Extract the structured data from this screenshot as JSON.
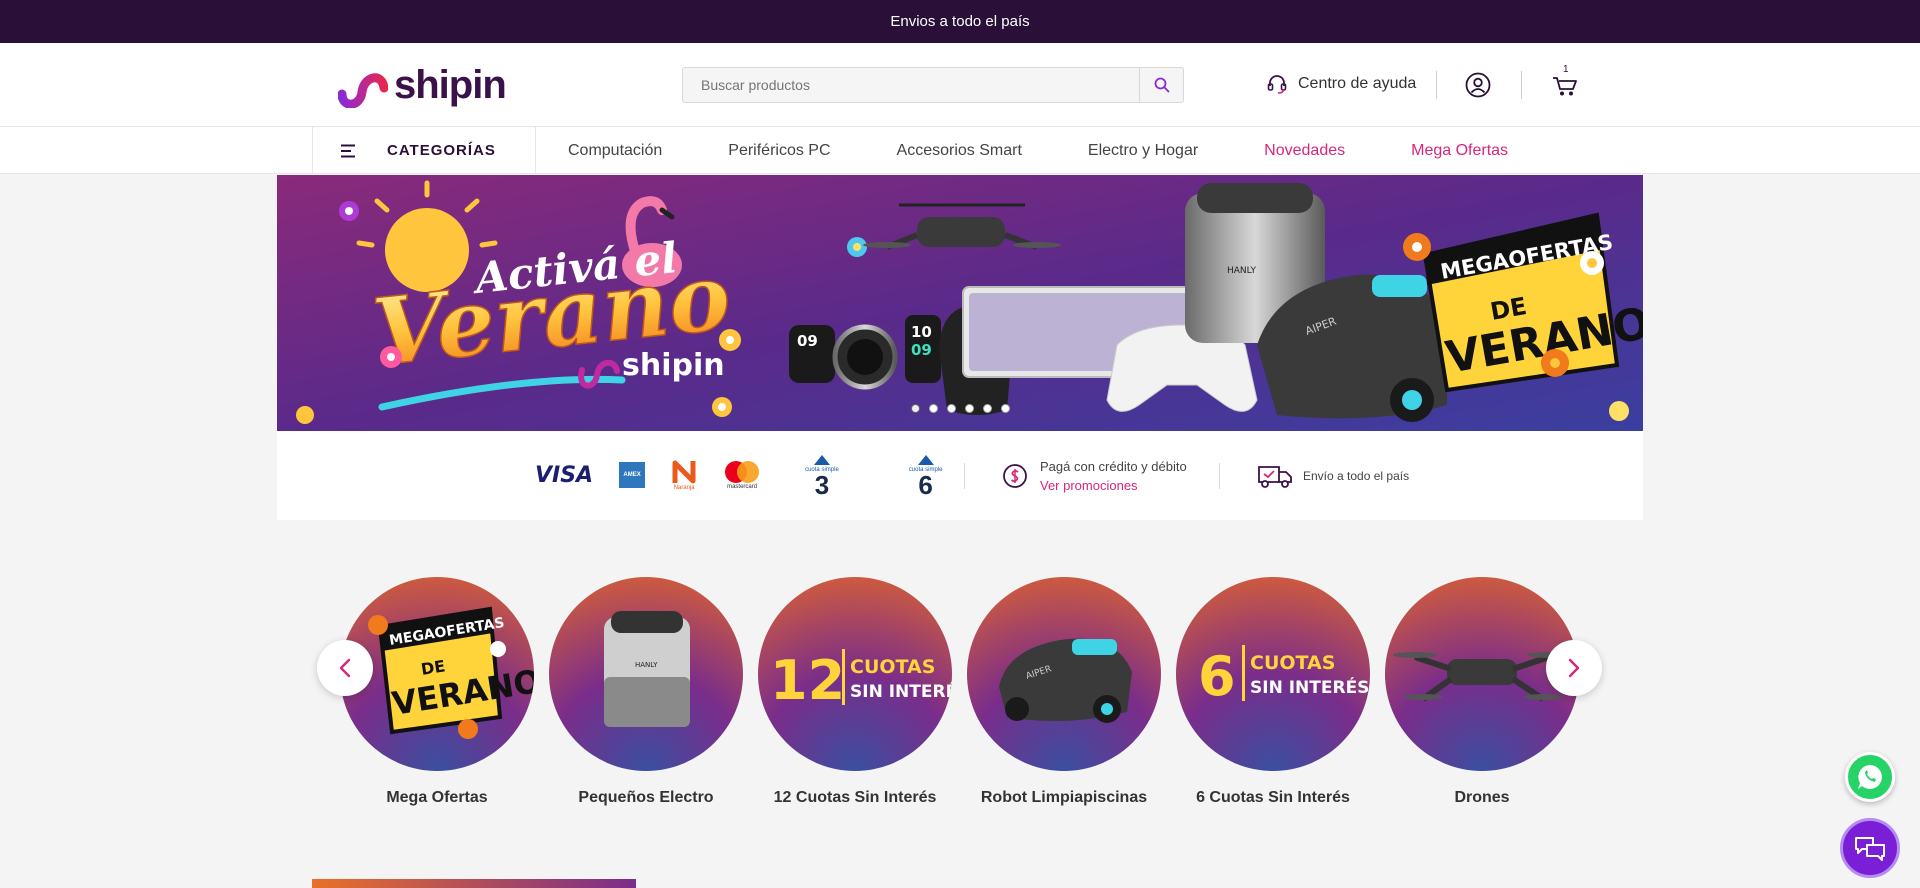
{
  "topbar": {
    "text": "Envios a todo el país"
  },
  "header": {
    "logo_text": "shipin",
    "search_placeholder": "Buscar productos",
    "help_label": "Centro de ayuda",
    "cart_count": "1"
  },
  "nav": {
    "categories_label": "CATEGORÍAS",
    "links": [
      {
        "label": "Computación"
      },
      {
        "label": "Periféricos PC"
      },
      {
        "label": "Accesorios Smart"
      },
      {
        "label": "Electro y Hogar"
      },
      {
        "label": "Novedades"
      },
      {
        "label": "Mega Ofertas"
      }
    ]
  },
  "banner": {
    "headline_line1": "Activá el",
    "headline_line2": "Verano",
    "brand": "shipin",
    "badge_line1": "MEGAOFERTAS",
    "badge_line2": "DE",
    "badge_line3": "VERANO",
    "watch_time_a": "09",
    "watch_time_b_1": "10",
    "watch_time_b_2": "09",
    "product_brand_1": "HANLY",
    "product_brand_2": "AIPER",
    "slide_count": 6,
    "active_slide": 1
  },
  "payments": {
    "logos": [
      "VISA",
      "AMEX",
      "Naranja",
      "mastercard",
      "3",
      "6"
    ],
    "cuota_simple_label": "cuota simple",
    "credit_text": "Pagá con crédito y débito",
    "promo_link": "Ver promociones",
    "shipping_text": "Envío a todo el país"
  },
  "categories": [
    {
      "label": "Mega Ofertas",
      "art_1": "MEGAOFERTAS",
      "art_2": "DE",
      "art_3": "VERANO"
    },
    {
      "label": "Pequeños Electro",
      "art_1": "HANLY"
    },
    {
      "label": "12 Cuotas Sin Interés",
      "art_1": "12",
      "art_2": "CUOTAS",
      "art_3": "SIN INTERÉS"
    },
    {
      "label": "Robot Limpiapiscinas",
      "art_1": "AIPER"
    },
    {
      "label": "6 Cuotas Sin Interés",
      "art_1": "6",
      "art_2": "CUOTAS",
      "art_3": "SIN INTERÉS"
    },
    {
      "label": "Drones"
    }
  ],
  "colors": {
    "topbar_bg": "#2a1038",
    "accent_pink": "#d6267e",
    "brand_purple": "#3a1249",
    "whatsapp": "#25d366",
    "chat": "#7b1fd6"
  }
}
